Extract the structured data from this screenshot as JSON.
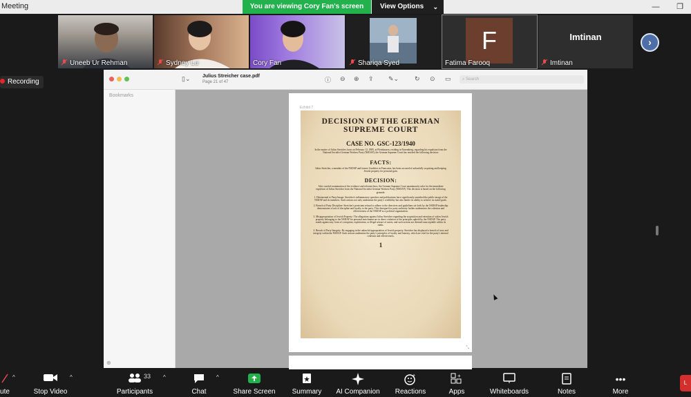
{
  "window": {
    "title": "Meeting"
  },
  "banner": {
    "viewing_text": "You are viewing Cory Fan's screen",
    "view_options_label": "View Options"
  },
  "participants": [
    {
      "name": "Uneeb Ur Rehman"
    },
    {
      "name": "Sydney Lu"
    },
    {
      "name": "Cory Fan"
    },
    {
      "name": "Shariqa Syed"
    },
    {
      "name": "Fatima Farooq",
      "avatar_letter": "F"
    },
    {
      "name": "Imtinan",
      "display_name": "Imtinan"
    }
  ],
  "recording": {
    "label": "Recording"
  },
  "pdf": {
    "filename": "Julius Streicher case.pdf",
    "page_info": "Page 21 of 47",
    "search_placeholder": "Search",
    "sidebar_header": "Bookmarks",
    "exhibit_label": "Exhibit 7",
    "document": {
      "heading": "DECISION OF THE GERMAN SUPREME COURT",
      "case_no": "CASE NO. GSC-123/1940",
      "intro": "In the matter of Julius Streicher, born on February 12, 1885, at Fleinhausen, residing in Nuremberg, regarding his expulsion from the National Socialist German Workers Party (NSDAP), the German Supreme Court has reached the following decision:",
      "facts_heading": "FACTS:",
      "facts_text": "Julius Streicher, a member of the NSDAP and former Gauleiter in Franconia, has been accused of unlawfully acquiring and keeping Jewish property for personal gain.",
      "decision_heading": "DECISION:",
      "decision_text": "After careful examination of the evidence and relevant laws, the German Supreme Court unanimously rules for the immediate expulsion of Julius Streicher from the National Socialist German Workers Party (NSDAP). This decision is based on the following grounds:",
      "ground1": "1. Detrimental to Party Image: Streicher's inflammatory speeches and publications have significantly tarnished the public image of the NSDAP and its members. Such actions not only undermine the party's credibility but also hinder its ability to achieve its stated goals.",
      "ground2": "2. Breach of Party Discipline: Streicher's persistent refusal to adhere to the directives and guidelines set forth by the NSDAP leadership demonstrates a lack of discipline and loyalty to the party. This disregard for party authority further undermines the cohesion and effectiveness of the NSDAP as a political organization.",
      "ground3": "3. Misappropriation of Jewish Property: The allegations against Julius Streicher regarding the acquisition and retention of stolen Jewish property belonging to the NSDAP for personal enrichment are in direct violation of the principles upheld by the NSDAP. The party stands against any form of corruption, exploitation, or illegal seizure of assets, and such actions are deemed unacceptable within its ranks.",
      "ground4": "4. Breach of Party Integrity: By engaging in the unlawful appropriation of Jewish property, Streicher has displayed a breach of trust and integrity within the NSDAP. Such actions undermine the party's principles of loyalty and honesty, which are vital for the party's internal cohesion and effectiveness.",
      "page_number": "1"
    }
  },
  "toolbar": {
    "mute": "ute",
    "stop_video": "Stop Video",
    "participants": "Participants",
    "participants_count": "33",
    "chat": "Chat",
    "share_screen": "Share Screen",
    "summary": "Summary",
    "ai_companion": "AI Companion",
    "reactions": "Reactions",
    "apps": "Apps",
    "whiteboards": "Whiteboards",
    "notes": "Notes",
    "more": "More",
    "end": "L"
  },
  "colors": {
    "share_green": "#22b14c",
    "record_red": "#e02828",
    "next_blue": "#4e6ea8",
    "avatar_brown": "#6b3e2e"
  }
}
